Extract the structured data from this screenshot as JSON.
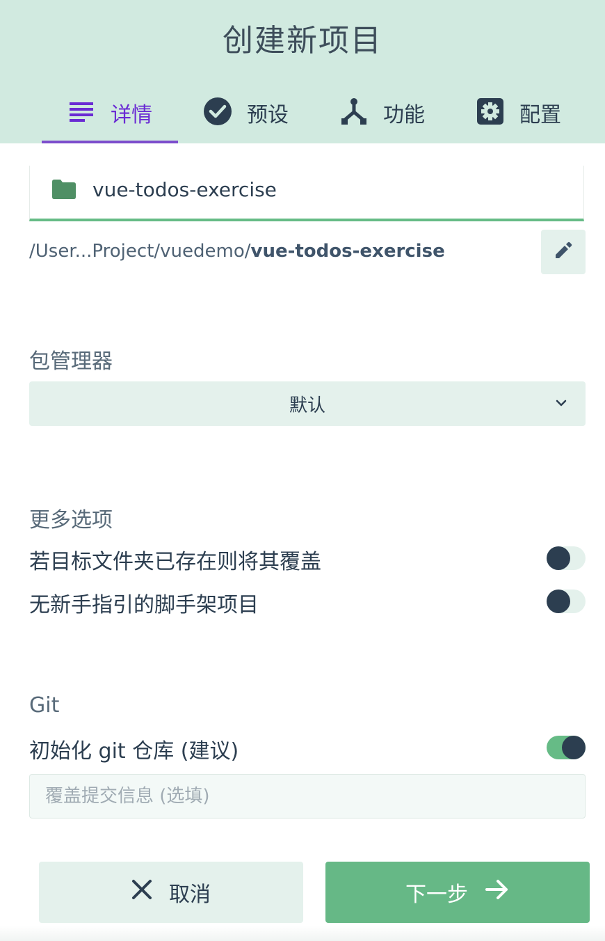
{
  "header": {
    "title": "创建新项目",
    "tabs": [
      {
        "label": "详情",
        "icon": "list-icon",
        "active": true
      },
      {
        "label": "预设",
        "icon": "check-circle-icon",
        "active": false
      },
      {
        "label": "功能",
        "icon": "fork-icon",
        "active": false
      },
      {
        "label": "配置",
        "icon": "settings-icon",
        "active": false
      }
    ]
  },
  "details": {
    "project_name": "vue-todos-exercise",
    "path_prefix": "/User...Project/vuedemo/",
    "path_folder": "vue-todos-exercise"
  },
  "package_manager": {
    "label": "包管理器",
    "selected": "默认"
  },
  "more_options": {
    "label": "更多选项",
    "items": [
      {
        "label": "若目标文件夹已存在则将其覆盖",
        "enabled": false
      },
      {
        "label": "无新手指引的脚手架项目",
        "enabled": false
      }
    ]
  },
  "git": {
    "label": "Git",
    "init_label": "初始化 git 仓库 (建议)",
    "init_enabled": true,
    "commit_placeholder": "覆盖提交信息 (选填)"
  },
  "actions": {
    "cancel_label": "取消",
    "next_label": "下一步"
  },
  "colors": {
    "header_bg": "#d1eae0",
    "accent_purple": "#6a2bd3",
    "accent_green": "#66bb86",
    "dark": "#2c3e50"
  }
}
